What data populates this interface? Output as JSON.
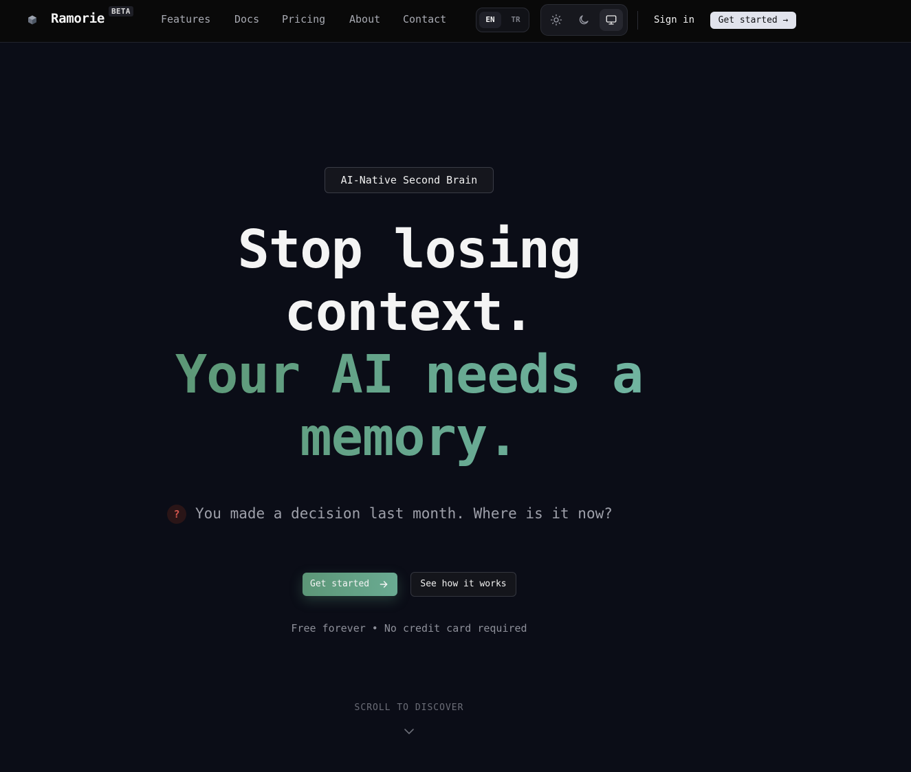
{
  "nav": {
    "brand": "Ramorie",
    "badge": "BETA",
    "links": [
      {
        "label": "Features"
      },
      {
        "label": "Docs"
      },
      {
        "label": "Pricing"
      },
      {
        "label": "About"
      },
      {
        "label": "Contact"
      }
    ],
    "languages": [
      {
        "label": "EN",
        "active": true
      },
      {
        "label": "TR",
        "active": false
      }
    ],
    "theme_options": [
      {
        "icon": "sun-icon"
      },
      {
        "icon": "moon-icon"
      },
      {
        "icon": "monitor-icon",
        "active": true
      }
    ],
    "sign_in": "Sign in",
    "cta": "Get started →"
  },
  "hero": {
    "badge": "AI-Native Second Brain",
    "headline_white": [
      "Stop losing",
      "context."
    ],
    "headline_green": [
      "Your AI needs a",
      "memory."
    ],
    "question_icon": "?",
    "question": "You made a decision last month. Where is it now?",
    "primary_cta": "Get started",
    "secondary_cta": "See how it works",
    "fine_print": "Free forever • No credit card required",
    "scroll_hint": "SCROLL TO DISCOVER"
  },
  "colors": {
    "background": "#0b0d17",
    "accent_green": "#67a890",
    "question_red": "#d2564e"
  }
}
